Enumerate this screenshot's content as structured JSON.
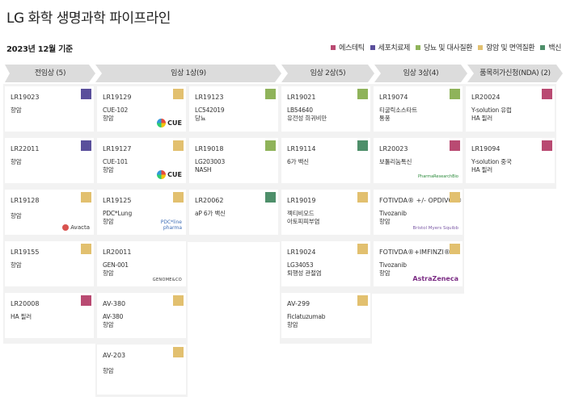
{
  "page_title": "LG 화학 생명과학 파이프라인",
  "as_of": "2023년 12월 기준",
  "legend": [
    {
      "label": "에스테틱",
      "color": "#b94a72"
    },
    {
      "label": "세포치료제",
      "color": "#5a4f9b"
    },
    {
      "label": "당뇨 및 대사질환",
      "color": "#8fb35a"
    },
    {
      "label": "항암 및 면역질환",
      "color": "#e2c06f"
    },
    {
      "label": "백신",
      "color": "#4e8f6a"
    }
  ],
  "phases": [
    {
      "label": "전임상 (5)"
    },
    {
      "label": "임상 1상(9)"
    },
    {
      "label": "임상 2상(5)"
    },
    {
      "label": "임상 3상(4)"
    },
    {
      "label": "품목허가신청(NDA) (2)"
    }
  ],
  "cards": [
    {
      "code": "LR19023",
      "desc": "항암",
      "color": "#5a4f9b",
      "partner": ""
    },
    {
      "code": "LR22011",
      "desc": "항암",
      "color": "#5a4f9b",
      "partner": ""
    },
    {
      "code": "LR19128",
      "desc": "항암",
      "color": "#e2c06f",
      "partner": "Avacta"
    },
    {
      "code": "LR19155",
      "desc": "항암",
      "color": "#e2c06f",
      "partner": ""
    },
    {
      "code": "LR20008",
      "desc": "HA 필러",
      "color": "#b94a72",
      "partner": ""
    },
    {
      "code": "LR19129",
      "desc": "CUE-102\n항암",
      "color": "#e2c06f",
      "partner": "CUE"
    },
    {
      "code": "LR19127",
      "desc": "CUE-101\n항암",
      "color": "#e2c06f",
      "partner": "CUE"
    },
    {
      "code": "LR19125",
      "desc": "PDC*Lung\n항암",
      "color": "#e2c06f",
      "partner": "PDC*line pharma"
    },
    {
      "code": "LR20011",
      "desc": "GEN-001\n항암",
      "color": "#e2c06f",
      "partner": "GENOME&CO"
    },
    {
      "code": "AV-380",
      "desc": "AV-380\n항암",
      "color": "#e2c06f",
      "partner": ""
    },
    {
      "code": "AV-203",
      "desc": "항암",
      "color": "#e2c06f",
      "partner": ""
    },
    {
      "code": "LR19123",
      "desc": "LC542019\n당뇨",
      "color": "#8fb35a",
      "partner": ""
    },
    {
      "code": "LR19018",
      "desc": "LG203003\nNASH",
      "color": "#8fb35a",
      "partner": ""
    },
    {
      "code": "LR20062",
      "desc": "aP 6가 백신",
      "color": "#4e8f6a",
      "partner": ""
    },
    {
      "code": "LR19021",
      "desc": "LB54640\n유전성 희귀비만",
      "color": "#8fb35a",
      "partner": ""
    },
    {
      "code": "LR19114",
      "desc": "6가 백신",
      "color": "#4e8f6a",
      "partner": ""
    },
    {
      "code": "LR19019",
      "desc": "젝티비모드\n아토피피부염",
      "color": "#e2c06f",
      "partner": ""
    },
    {
      "code": "LR19024",
      "desc": "LG34053\n퇴행성 관절염",
      "color": "#e2c06f",
      "partner": ""
    },
    {
      "code": "AV-299",
      "desc": "Ficlatuzumab\n항암",
      "color": "#e2c06f",
      "partner": ""
    },
    {
      "code": "LR19074",
      "desc": "티굴릭소스타트\n통풍",
      "color": "#8fb35a",
      "partner": ""
    },
    {
      "code": "LR20023",
      "desc": "보툴리눔톡신",
      "color": "#b94a72",
      "partner": "PharmaResearchBio"
    },
    {
      "code": "FOTIVDA® +/- OPDIVO ®",
      "desc": "Tivozanib\n항암",
      "color": "#e2c06f",
      "partner": "Bristol Myers Squibb"
    },
    {
      "code": "FOTIVDA®+IMFINZI®",
      "desc": "Tivozanib\n항암",
      "color": "#e2c06f",
      "partner": "AstraZeneca"
    },
    {
      "code": "LR20024",
      "desc": "Y-solution 유럽\nHA 필러",
      "color": "#b94a72",
      "partner": ""
    },
    {
      "code": "LR19094",
      "desc": "Y-solution 중국\nHA 필러",
      "color": "#b94a72",
      "partner": ""
    }
  ]
}
